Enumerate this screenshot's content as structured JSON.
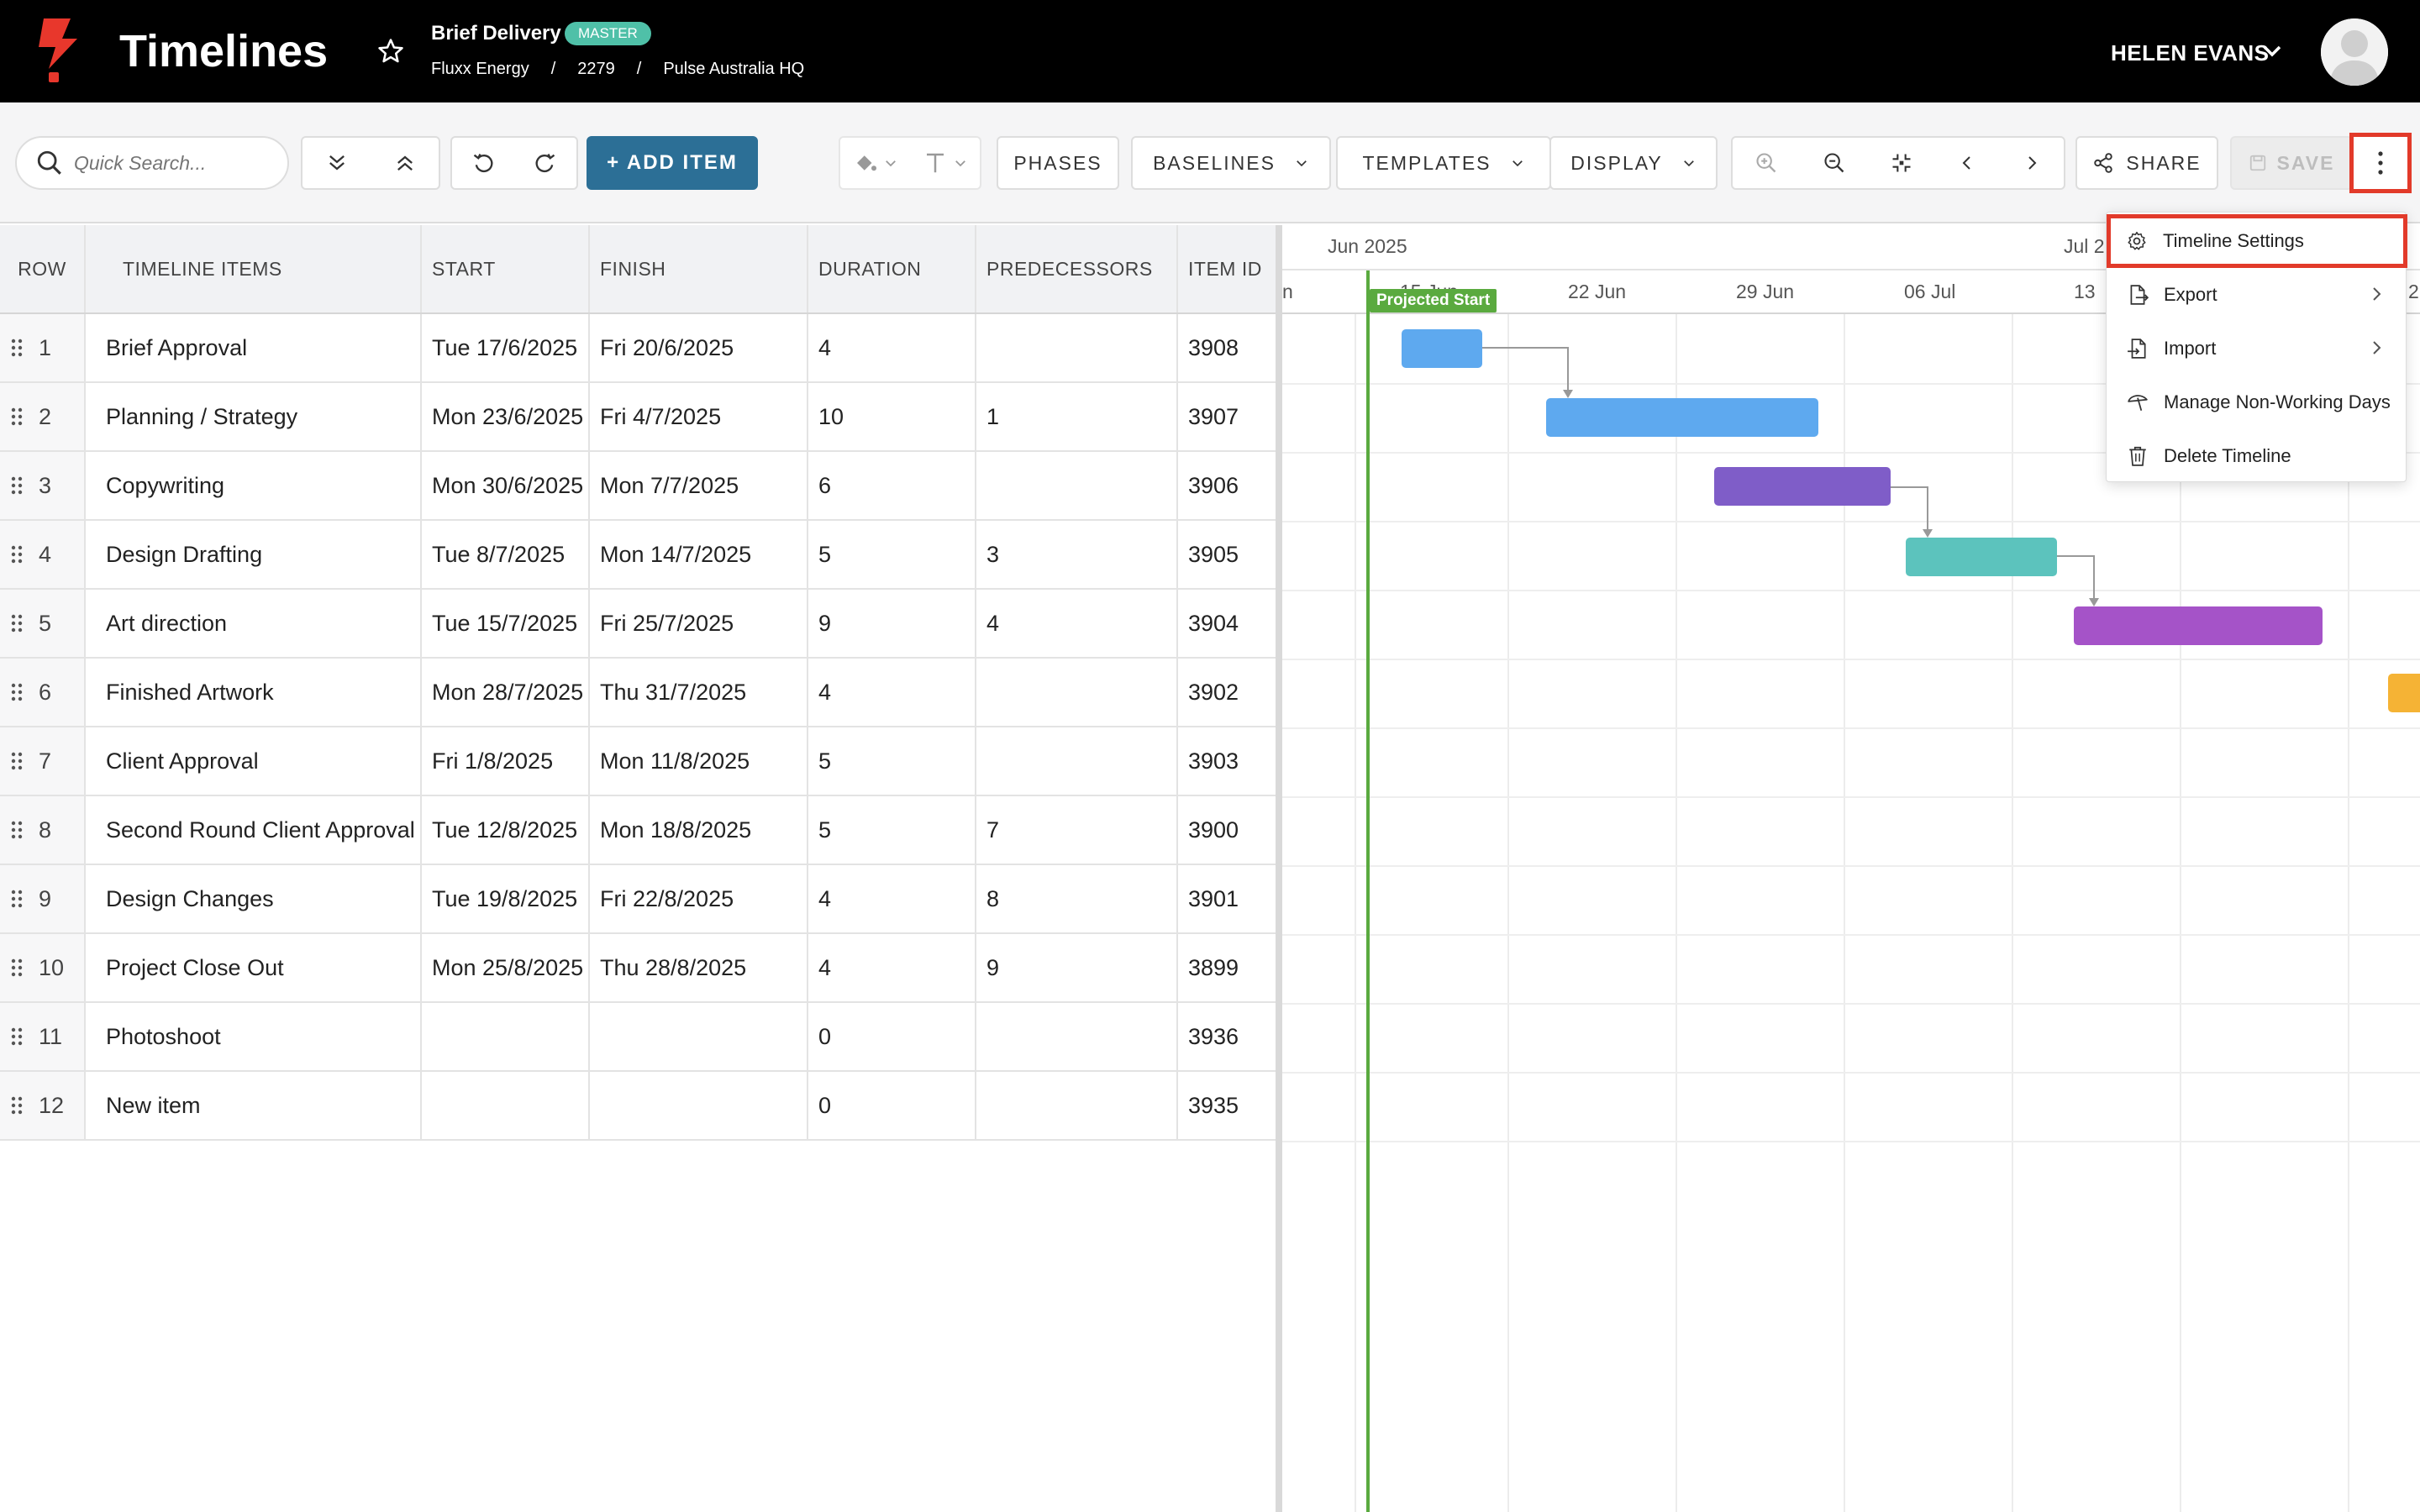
{
  "header": {
    "app_title": "Timelines",
    "project_name": "Brief Delivery",
    "badge": "MASTER",
    "breadcrumb": [
      "Fluxx Energy",
      "2279",
      "Pulse Australia HQ"
    ],
    "separator": "/",
    "user_name": "HELEN EVANS"
  },
  "toolbar": {
    "search_placeholder": "Quick Search...",
    "add_item": "+ ADD ITEM",
    "phases": "PHASES",
    "baselines": "BASELINES",
    "templates": "TEMPLATES",
    "display": "DISPLAY",
    "share": "SHARE",
    "save": "SAVE"
  },
  "grid": {
    "columns": [
      "ROW",
      "TIMELINE ITEMS",
      "START",
      "FINISH",
      "DURATION",
      "PREDECESSORS",
      "ITEM ID"
    ],
    "rows": [
      {
        "row": "1",
        "name": "Brief Approval",
        "start": "Tue 17/6/2025",
        "finish": "Fri 20/6/2025",
        "duration": "4",
        "pred": "",
        "id": "3908"
      },
      {
        "row": "2",
        "name": "Planning / Strategy",
        "start": "Mon 23/6/2025",
        "finish": "Fri 4/7/2025",
        "duration": "10",
        "pred": "1",
        "id": "3907"
      },
      {
        "row": "3",
        "name": "Copywriting",
        "start": "Mon 30/6/2025",
        "finish": "Mon 7/7/2025",
        "duration": "6",
        "pred": "",
        "id": "3906"
      },
      {
        "row": "4",
        "name": "Design Drafting",
        "start": "Tue 8/7/2025",
        "finish": "Mon 14/7/2025",
        "duration": "5",
        "pred": "3",
        "id": "3905"
      },
      {
        "row": "5",
        "name": "Art direction",
        "start": "Tue 15/7/2025",
        "finish": "Fri 25/7/2025",
        "duration": "9",
        "pred": "4",
        "id": "3904"
      },
      {
        "row": "6",
        "name": "Finished Artwork",
        "start": "Mon 28/7/2025",
        "finish": "Thu 31/7/2025",
        "duration": "4",
        "pred": "",
        "id": "3902"
      },
      {
        "row": "7",
        "name": "Client Approval",
        "start": "Fri 1/8/2025",
        "finish": "Mon 11/8/2025",
        "duration": "5",
        "pred": "",
        "id": "3903"
      },
      {
        "row": "8",
        "name": "Second Round Client Approval",
        "start": "Tue 12/8/2025",
        "finish": "Mon 18/8/2025",
        "duration": "5",
        "pred": "7",
        "id": "3900"
      },
      {
        "row": "9",
        "name": "Design Changes",
        "start": "Tue 19/8/2025",
        "finish": "Fri 22/8/2025",
        "duration": "4",
        "pred": "8",
        "id": "3901"
      },
      {
        "row": "10",
        "name": "Project Close Out",
        "start": "Mon 25/8/2025",
        "finish": "Thu 28/8/2025",
        "duration": "4",
        "pred": "9",
        "id": "3899"
      },
      {
        "row": "11",
        "name": "Photoshoot",
        "start": "",
        "finish": "",
        "duration": "0",
        "pred": "",
        "id": "3936"
      },
      {
        "row": "12",
        "name": "New item",
        "start": "",
        "finish": "",
        "duration": "0",
        "pred": "",
        "id": "3935"
      }
    ]
  },
  "gantt": {
    "months": [
      "Jun 2025",
      "Jul 2"
    ],
    "weeks": [
      "n",
      "15 Jun",
      "22 Jun",
      "29 Jun",
      "06 Jul",
      "13",
      "2"
    ],
    "projected_start_label": "Projected Start",
    "bar_colors": {
      "brief_approval": "#5ea9ef",
      "planning": "#5ea9ef",
      "copywriting": "#7f5dc8",
      "design_drafting": "#5cc3bd",
      "art_direction": "#a553c8",
      "finished_artwork": "#f5b335"
    }
  },
  "menu": {
    "items": [
      "Timeline Settings",
      "Export",
      "Import",
      "Manage Non-Working Days",
      "Delete Timeline"
    ]
  },
  "colors": {
    "header_bg": "#000000",
    "accent": "#2c6f96",
    "badge": "#4fc0a8",
    "highlight": "#e23a2a",
    "projected": "#5aaa3f"
  }
}
